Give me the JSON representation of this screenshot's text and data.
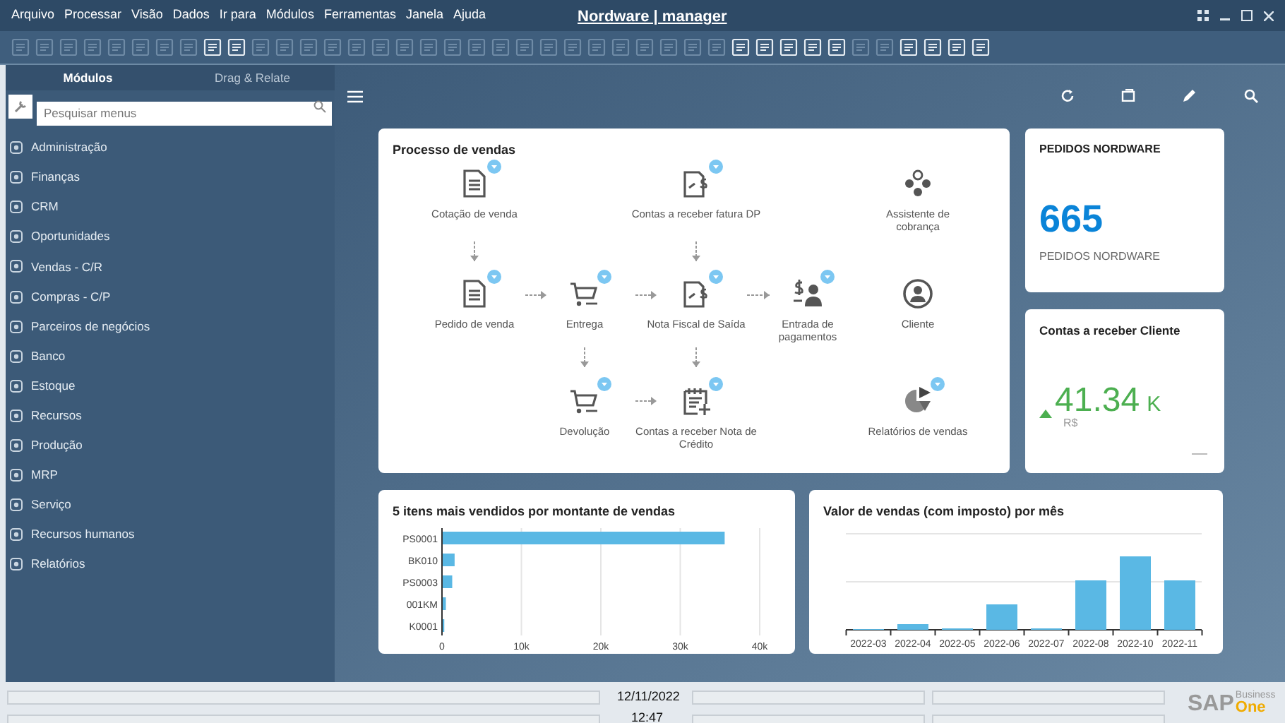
{
  "menu_bar": {
    "items": [
      "Arquivo",
      "Processar",
      "Visão",
      "Dados",
      "Ir para",
      "Módulos",
      "Ferramentas",
      "Janela",
      "Ajuda"
    ]
  },
  "window": {
    "title": "Nordware | manager"
  },
  "toolbar": {
    "icons": [
      {
        "disabled": true
      },
      {
        "disabled": true
      },
      {
        "disabled": true
      },
      {
        "disabled": true
      },
      {
        "disabled": true
      },
      {
        "disabled": true
      },
      {
        "disabled": true
      },
      {
        "disabled": true
      },
      {
        "disabled": false
      },
      {
        "disabled": false
      },
      {
        "disabled": true
      },
      {
        "disabled": true
      },
      {
        "disabled": true
      },
      {
        "disabled": true
      },
      {
        "disabled": true
      },
      {
        "disabled": true
      },
      {
        "disabled": true
      },
      {
        "disabled": true
      },
      {
        "disabled": true
      },
      {
        "disabled": true
      },
      {
        "disabled": true
      },
      {
        "disabled": true
      },
      {
        "disabled": true
      },
      {
        "disabled": true
      },
      {
        "disabled": true
      },
      {
        "disabled": true
      },
      {
        "disabled": true
      },
      {
        "disabled": true
      },
      {
        "disabled": true
      },
      {
        "disabled": true
      },
      {
        "disabled": false
      },
      {
        "disabled": false
      },
      {
        "disabled": false
      },
      {
        "disabled": false
      },
      {
        "disabled": false
      },
      {
        "disabled": true
      },
      {
        "disabled": true
      },
      {
        "disabled": false
      },
      {
        "disabled": false
      },
      {
        "disabled": false
      },
      {
        "disabled": false
      }
    ]
  },
  "sidebar": {
    "tabs": [
      {
        "label": "Módulos",
        "selected": true
      },
      {
        "label": "Drag & Relate",
        "selected": false
      }
    ],
    "search": {
      "placeholder": "Pesquisar menus"
    },
    "items": [
      "Administração",
      "Finanças",
      "CRM",
      "Oportunidades",
      "Vendas - C/R",
      "Compras - C/P",
      "Parceiros de negócios",
      "Banco",
      "Estoque",
      "Recursos",
      "Produção",
      "MRP",
      "Serviço",
      "Recursos humanos",
      "Relatórios"
    ]
  },
  "process": {
    "title": "Processo de vendas",
    "nodes": [
      {
        "label": "Cotação de venda",
        "kind": "document",
        "menu_badge": true
      },
      {
        "label": "Contas a receber fatura DP",
        "kind": "invoice",
        "menu_badge": true
      },
      {
        "label": "Assistente de cobrança",
        "kind": "dots",
        "menu_badge": false
      },
      {
        "label": "Pedido de venda",
        "kind": "document",
        "menu_badge": true
      },
      {
        "label": "Entrega",
        "kind": "cart",
        "menu_badge": true
      },
      {
        "label": "Nota Fiscal de Saída",
        "kind": "invoice",
        "menu_badge": true
      },
      {
        "label": "Entrada de pagamentos",
        "kind": "payment",
        "menu_badge": true
      },
      {
        "label": "Cliente",
        "kind": "user",
        "menu_badge": false
      },
      {
        "label": "Devolução",
        "kind": "cart",
        "menu_badge": true
      },
      {
        "label": "Contas a receber Nota de Crédito",
        "kind": "calendar",
        "menu_badge": true
      },
      {
        "label": "Relatórios de vendas",
        "kind": "pie",
        "menu_badge": true
      }
    ]
  },
  "kpi_orders": {
    "title": "PEDIDOS NORDWARE",
    "value": "665",
    "caption": "PEDIDOS NORDWARE"
  },
  "kpi_receivables": {
    "title": "Contas a receber Cliente",
    "rising": true,
    "value": "41.34",
    "unit": "K",
    "currency": "R$"
  },
  "top_items": {
    "chart_data": {
      "type": "bar",
      "orientation": "horizontal",
      "title": "5 itens mais vendidos por montante de vendas",
      "categories": [
        "PS0001",
        "BK010",
        "PS0003",
        "001KM",
        "K0001"
      ],
      "grid": true,
      "series": [
        {
          "color": "#5ab8e4",
          "values": [
            35500,
            1500,
            1200,
            400,
            200
          ]
        }
      ],
      "xlim": [
        0,
        40000
      ],
      "xticks": [
        {
          "value": 0,
          "label": "0"
        },
        {
          "value": 10000,
          "label": "10k"
        },
        {
          "value": 20000,
          "label": "20k"
        },
        {
          "value": 30000,
          "label": "30k"
        },
        {
          "value": 40000,
          "label": "40k"
        }
      ]
    }
  },
  "monthly_sales": {
    "title": "Valor de vendas (com imposto) por mês",
    "months": [
      "2022-03",
      "2022-04",
      "2022-05",
      "2022-06",
      "2022-07",
      "2022-08",
      "2022-10",
      "2022-11"
    ]
  },
  "status_bar": {
    "date": "12/11/2022",
    "time": "12:47",
    "logo": {
      "brand": "SAP",
      "line1": "Business",
      "line2": "One"
    }
  }
}
